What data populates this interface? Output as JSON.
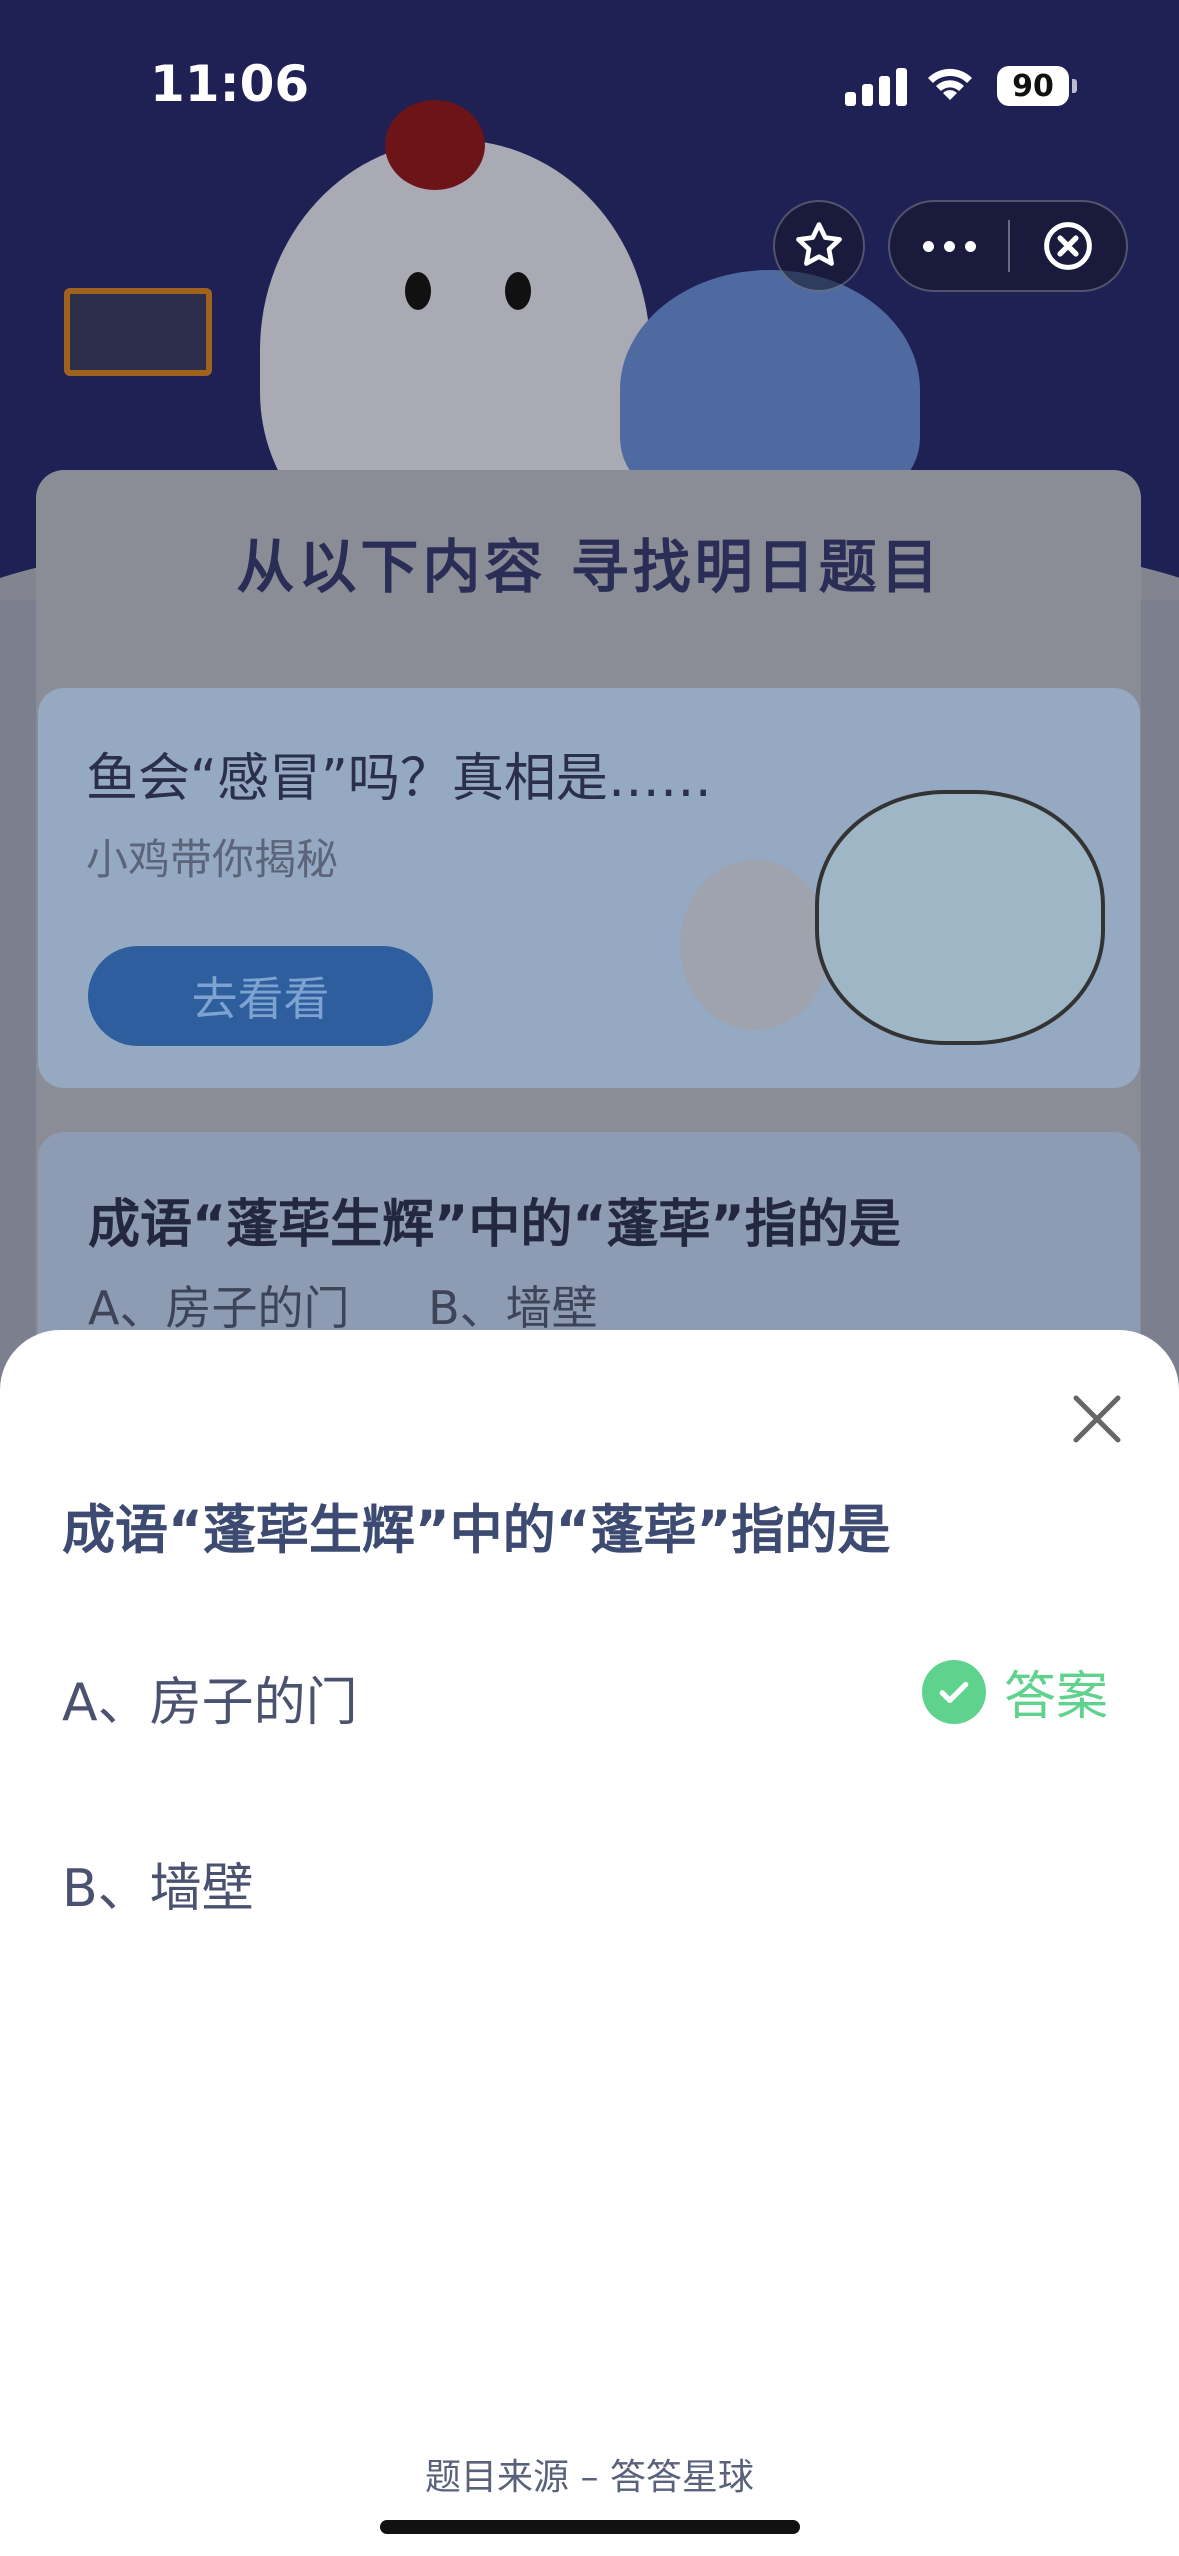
{
  "status_bar": {
    "time": "11:06",
    "battery": "90"
  },
  "background": {
    "heading": "从以下内容 寻找明日题目",
    "article_card": {
      "title": "鱼会“感冒”吗？真相是……",
      "subtitle": "小鸡带你揭秘",
      "button_label": "去看看"
    },
    "quiz_card": {
      "question": "成语“蓬荜生辉”中的“蓬荜”指的是",
      "option_a": "A、房子的门",
      "option_b": "B、墙壁"
    }
  },
  "sheet": {
    "question": "成语“蓬荜生辉”中的“蓬荜”指的是",
    "options": [
      {
        "label": "A、房子的门",
        "is_answer": true
      },
      {
        "label": "B、墙壁",
        "is_answer": false
      }
    ],
    "answer_tag": "答案",
    "source": "题目来源 – 答答星球"
  },
  "icons": [
    "star-icon",
    "more-icon",
    "close-circle-icon",
    "close-icon",
    "check-icon",
    "wifi-icon",
    "signal-icon"
  ],
  "colors": {
    "accent_green": "#5fd38d",
    "title_color": "#3d4b72",
    "header_bg": "#1f2154"
  }
}
